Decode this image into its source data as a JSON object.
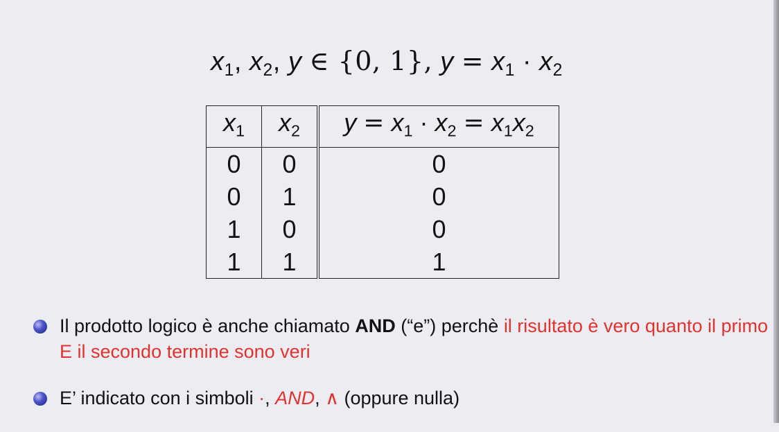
{
  "formula": {
    "x1": "x",
    "x2": "x",
    "y": "y",
    "sub1": "1",
    "sub2": "2",
    "in_set": "∈ {0, 1},",
    "equals": "=",
    "dot": "·"
  },
  "table": {
    "headers": [
      "x1",
      "x2",
      "y = x1 · x2 = x1x2"
    ],
    "rows": [
      [
        "0",
        "0",
        "0"
      ],
      [
        "0",
        "1",
        "0"
      ],
      [
        "1",
        "0",
        "0"
      ],
      [
        "1",
        "1",
        "1"
      ]
    ]
  },
  "bullets": [
    {
      "text_before": "Il prodotto logico è anche chiamato ",
      "bold": "AND",
      "text_mid": " (“e”) perchè ",
      "red": "il risultato è vero quanto il primo E il secondo termine sono veri"
    },
    {
      "text_before": "E’ indicato con i simboli ",
      "red_dot": "·",
      "comma1": ", ",
      "red_and": "AND",
      "comma2": ", ",
      "wedge": "∧",
      "text_after": " (oppure nulla)"
    }
  ],
  "colors": {
    "background": "#ecedf3",
    "highlight": "#e3322e",
    "bullet": "#4d55c9"
  }
}
